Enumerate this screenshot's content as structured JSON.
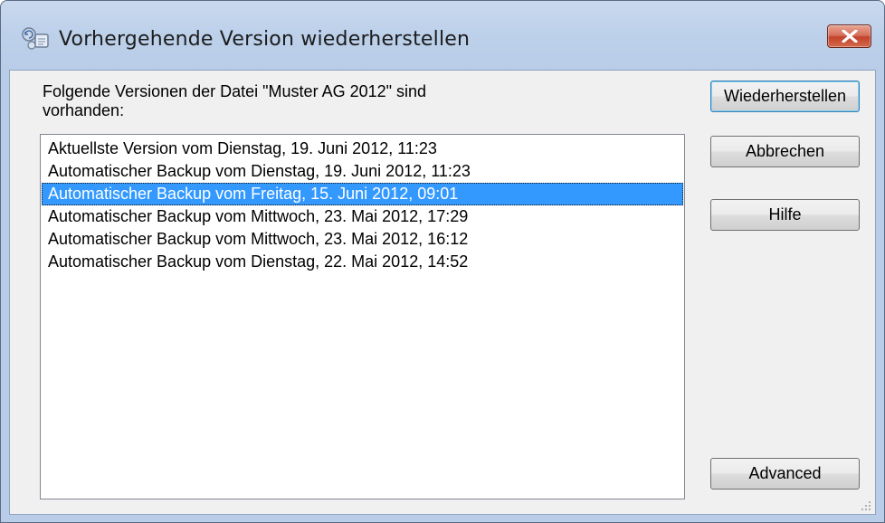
{
  "window": {
    "title": "Vorhergehende Version wiederherstellen",
    "title_icon": "restore-version-icon",
    "close_icon": "close-icon"
  },
  "dialog": {
    "prompt": "Folgende Versionen der Datei \"Muster AG 2012\" sind\nvorhanden:",
    "versions": [
      "Aktuellste Version vom Dienstag, 19. Juni 2012, 11:23",
      "Automatischer Backup vom Dienstag, 19. Juni 2012, 11:23",
      "Automatischer Backup vom Freitag, 15. Juni 2012, 09:01",
      "Automatischer Backup vom Mittwoch, 23. Mai 2012, 17:29",
      "Automatischer Backup vom Mittwoch, 23. Mai 2012, 16:12",
      "Automatischer Backup vom Dienstag, 22. Mai 2012, 14:52"
    ],
    "selected_version": "Automatischer Backup vom Freitag, 15. Juni 2012, 09:01"
  },
  "buttons": {
    "restore": "Wiederherstellen",
    "cancel": "Abbrechen",
    "help": "Hilfe",
    "advanced": "Advanced"
  },
  "colors": {
    "selection": "#3399ff",
    "close_button": "#c3432b",
    "frame": "#b9cde8"
  }
}
